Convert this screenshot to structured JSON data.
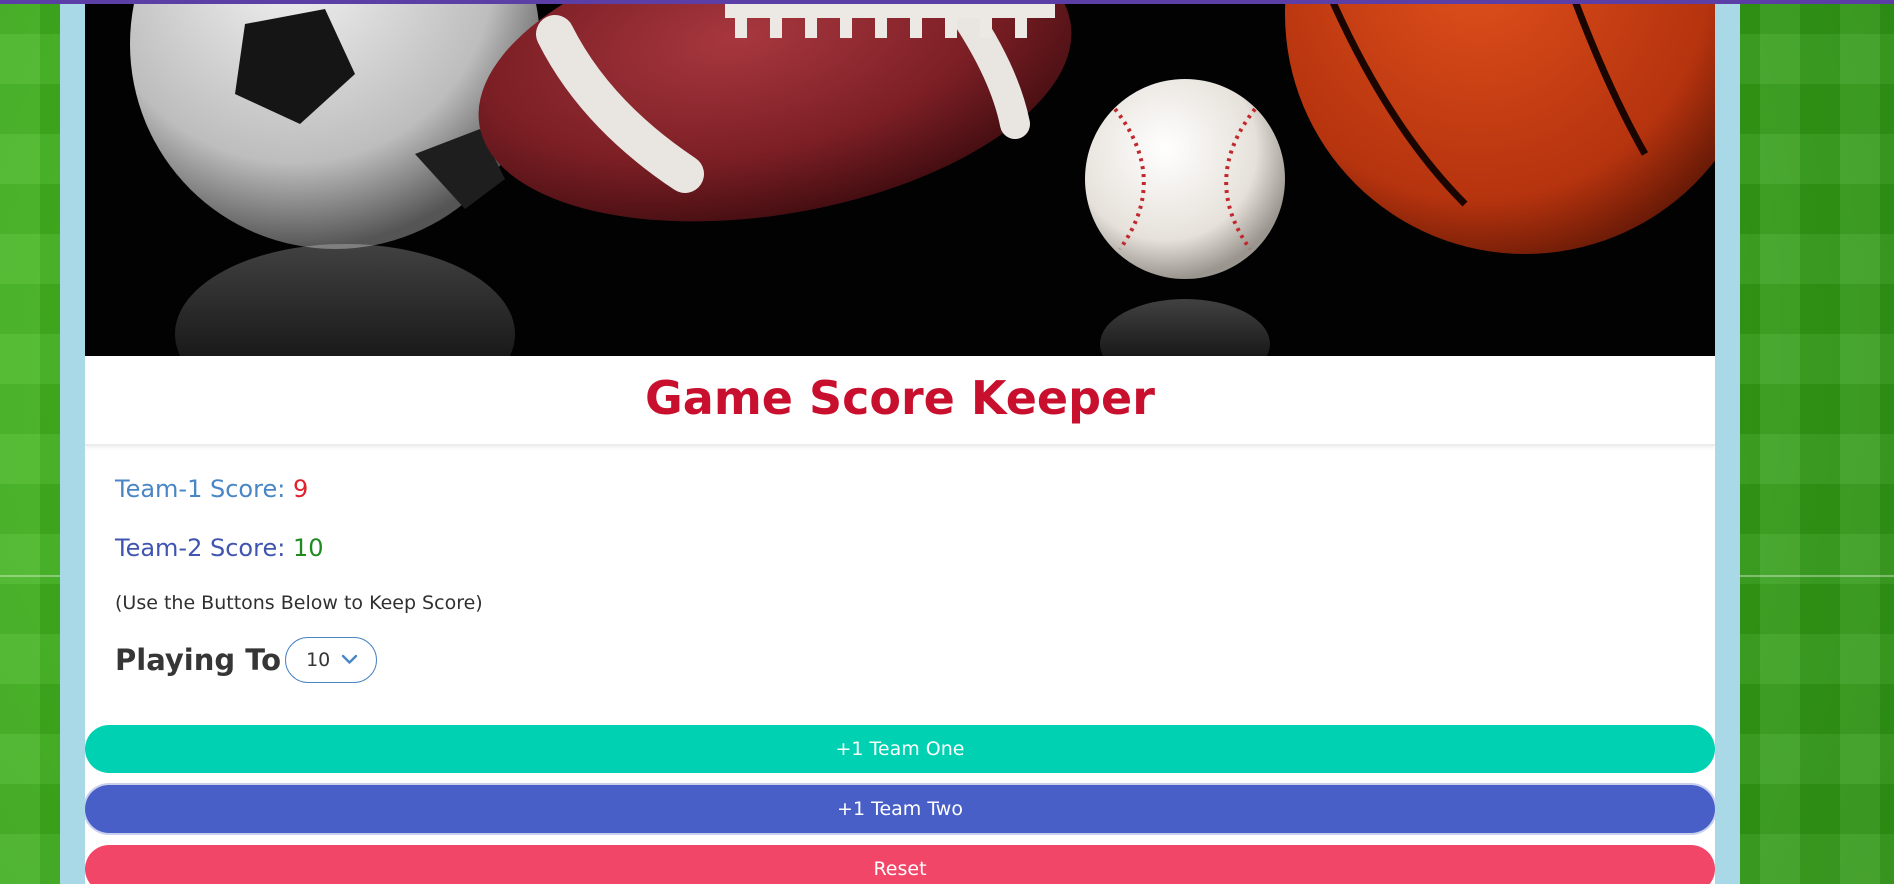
{
  "app": {
    "title": "Game Score Keeper"
  },
  "scores": {
    "team1_label": "Team-1 Score: ",
    "team1_value": "9",
    "team2_label": "Team-2 Score: ",
    "team2_value": "10"
  },
  "instructions": "(Use the Buttons Below to Keep Score)",
  "playing_to": {
    "label": "Playing To",
    "selected": "10"
  },
  "buttons": {
    "team_one": "+1 Team One",
    "team_two": "+1 Team Two",
    "reset": "Reset"
  },
  "colors": {
    "title": "#c8102e",
    "team1_score": "#e0202a",
    "team2_score": "#1f8a1f",
    "btn_team_one": "#00d1b2",
    "btn_team_two": "#485fc7",
    "btn_reset": "#f14668"
  },
  "icons": {
    "select_arrow": "chevron-down-icon"
  }
}
